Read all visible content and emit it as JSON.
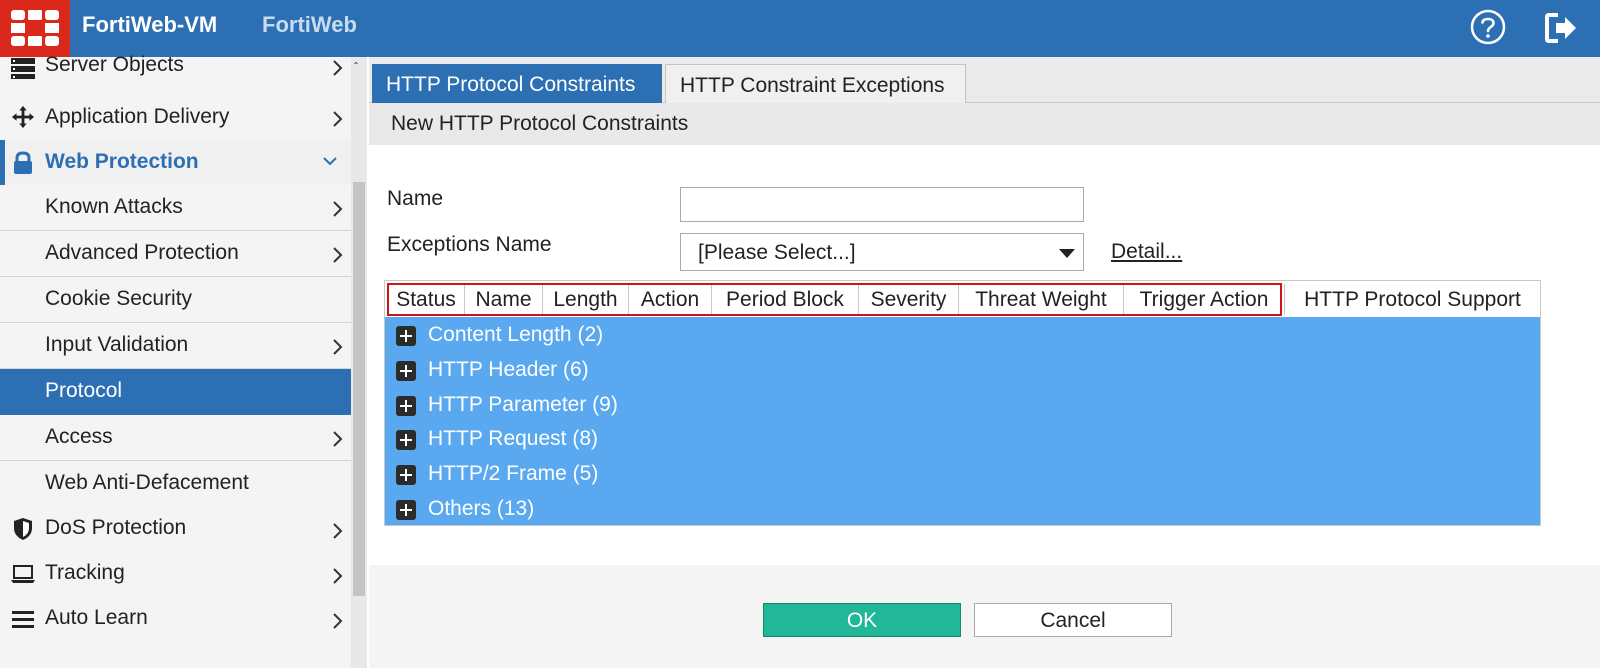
{
  "header": {
    "title": "FortiWeb-VM",
    "subtitle": "FortiWeb",
    "icons": [
      "fortinet-logo-icon",
      "help-icon",
      "logout-icon"
    ],
    "brand_color": "#2d6fb3",
    "logo_color": "#da291c"
  },
  "sidebar": {
    "items": [
      {
        "label": "Server Objects",
        "icon": "server-icon"
      },
      {
        "label": "Application Delivery",
        "icon": "move-arrows-icon"
      },
      {
        "label": "Web Protection",
        "icon": "lock-icon",
        "expanded": true
      },
      {
        "label": "Known Attacks"
      },
      {
        "label": "Advanced Protection"
      },
      {
        "label": "Cookie Security"
      },
      {
        "label": "Input Validation"
      },
      {
        "label": "Protocol",
        "selected": true
      },
      {
        "label": "Access"
      },
      {
        "label": "Web Anti-Defacement"
      },
      {
        "label": "DoS Protection",
        "icon": "shield-icon"
      },
      {
        "label": "Tracking",
        "icon": "laptop-icon"
      },
      {
        "label": "Auto Learn",
        "icon": "menu-lines-icon"
      }
    ]
  },
  "tabs": [
    {
      "label": "HTTP Protocol Constraints",
      "active": true
    },
    {
      "label": "HTTP Constraint Exceptions",
      "active": false
    }
  ],
  "subheader": "New HTTP Protocol Constraints",
  "form": {
    "name_label": "Name",
    "name_value": "",
    "exceptions_label": "Exceptions Name",
    "exceptions_value": "[Please Select...]",
    "detail_link": "Detail..."
  },
  "grid": {
    "columns": [
      "Status",
      "Name",
      "Length",
      "Action",
      "Period Block",
      "Severity",
      "Threat Weight",
      "Trigger Action",
      "HTTP Protocol Support"
    ],
    "groups": [
      "Content Length (2)",
      "HTTP Header (6)",
      "HTTP Parameter (9)",
      "HTTP Request (8)",
      "HTTP/2 Frame (5)",
      "Others (13)"
    ],
    "row_color": "#5aa8f0",
    "highlight_color": "#d0121b"
  },
  "buttons": {
    "ok": "OK",
    "cancel": "Cancel",
    "ok_color": "#21b797"
  }
}
